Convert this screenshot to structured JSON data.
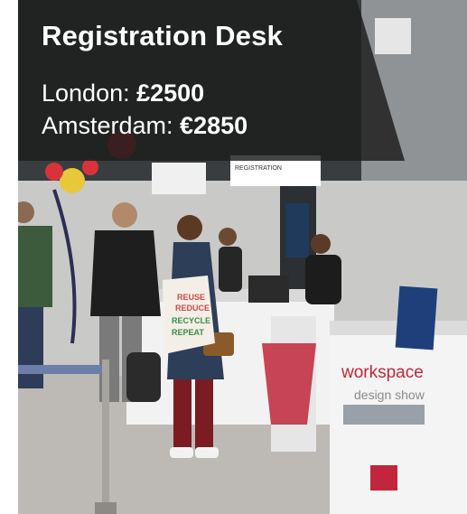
{
  "card": {
    "title": "Registration Desk",
    "prices": [
      {
        "label": "London: ",
        "amount": "£2500"
      },
      {
        "label": "Amsterdam: ",
        "amount": "€2850"
      }
    ]
  },
  "photo": {
    "registration_sign": "REGISTRATION",
    "desk_brand": "workspace",
    "desk_subtitle": "design show",
    "bag_text": [
      "REUSE",
      "REDUCE",
      "RECYCLE",
      "REPEAT"
    ]
  },
  "colors": {
    "overlay": "#1c1c1c",
    "brand_red": "#c0273a",
    "desk": "#f2f2f2"
  }
}
